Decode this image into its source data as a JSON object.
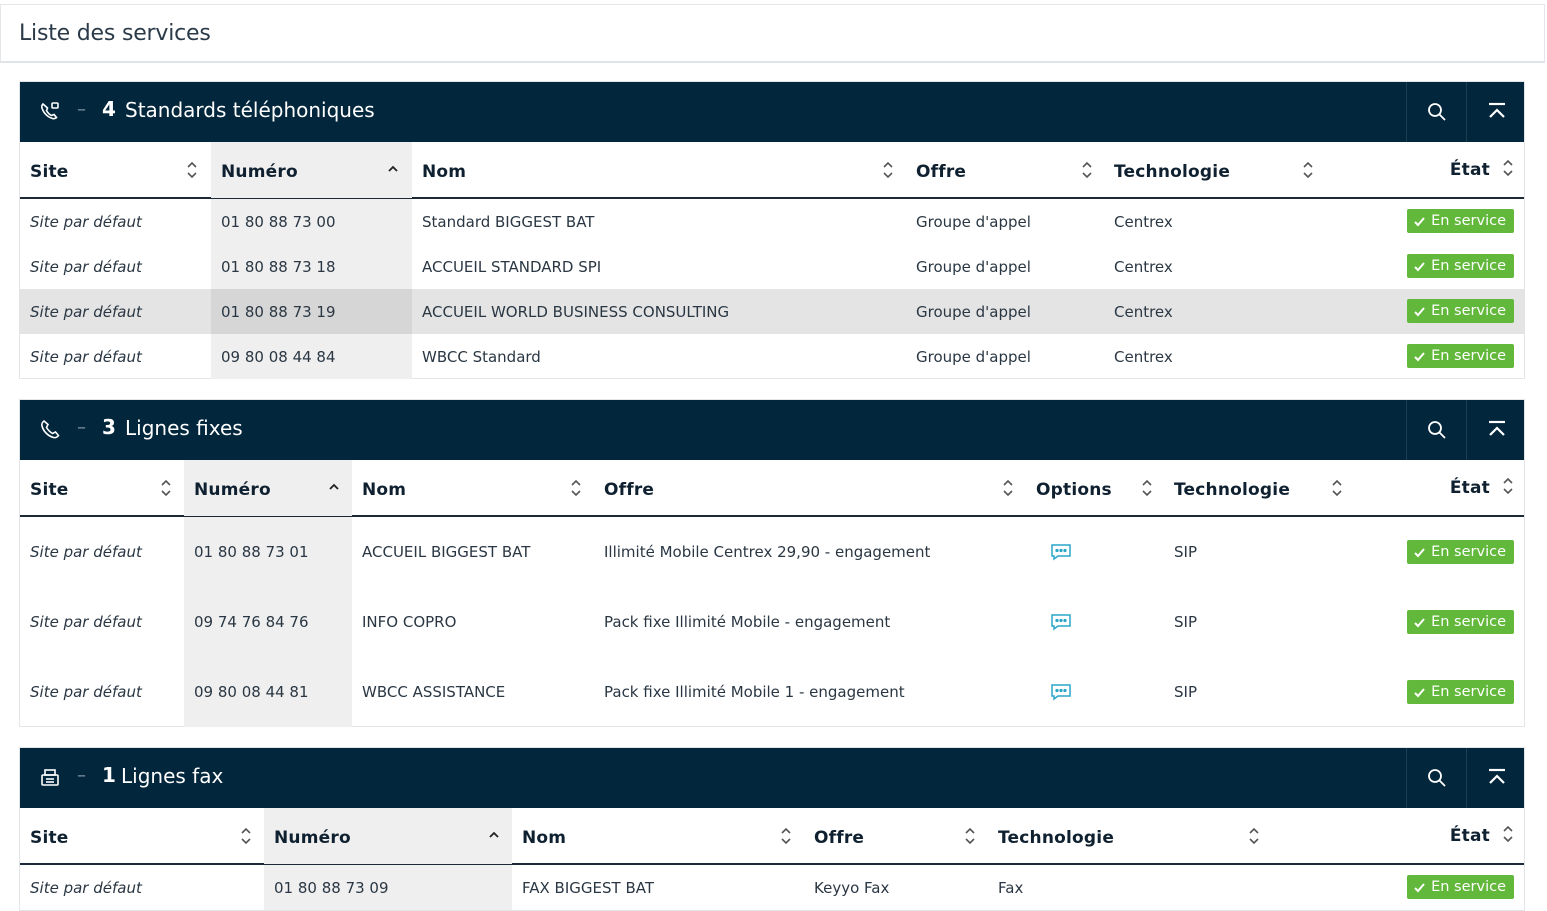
{
  "page": {
    "title": "Liste des services"
  },
  "status_color": "#62b83a",
  "header_color": "#02263c",
  "sections": [
    {
      "icon": "phone-switchboard-icon",
      "count": "4",
      "title": "Standards téléphoniques",
      "columns": [
        "Site",
        "Numéro",
        "Nom",
        "Offre",
        "Technologie",
        "État"
      ],
      "rows": [
        {
          "site": "Site par défaut",
          "numero": "01 80 88 73 00",
          "nom": "Standard BIGGEST BAT",
          "offre": "Groupe d'appel",
          "technologie": "Centrex",
          "etat": "En service"
        },
        {
          "site": "Site par défaut",
          "numero": "01 80 88 73 18",
          "nom": "ACCUEIL STANDARD SPI",
          "offre": "Groupe d'appel",
          "technologie": "Centrex",
          "etat": "En service"
        },
        {
          "site": "Site par défaut",
          "numero": "01 80 88 73 19",
          "nom": "ACCUEIL WORLD BUSINESS CONSULTING",
          "offre": "Groupe d'appel",
          "technologie": "Centrex",
          "etat": "En service"
        },
        {
          "site": "Site par défaut",
          "numero": "09 80 08 44 84",
          "nom": "WBCC Standard",
          "offre": "Groupe d'appel",
          "technologie": "Centrex",
          "etat": "En service"
        }
      ]
    },
    {
      "icon": "phone-icon",
      "count": "3",
      "title": "Lignes fixes",
      "columns": [
        "Site",
        "Numéro",
        "Nom",
        "Offre",
        "Options",
        "Technologie",
        "État"
      ],
      "rows": [
        {
          "site": "Site par défaut",
          "numero": "01 80 88 73 01",
          "nom": "ACCUEIL BIGGEST BAT",
          "offre": "Illimité Mobile Centrex 29,90 - engagement",
          "options": "message-icon",
          "technologie": "SIP",
          "etat": "En service"
        },
        {
          "site": "Site par défaut",
          "numero": "09 74 76 84 76",
          "nom": "INFO COPRO",
          "offre": "Pack fixe Illimité Mobile - engagement",
          "options": "message-icon",
          "technologie": "SIP",
          "etat": "En service"
        },
        {
          "site": "Site par défaut",
          "numero": "09 80 08 44 81",
          "nom": "WBCC ASSISTANCE",
          "offre": "Pack fixe Illimité Mobile 1 - engagement",
          "options": "message-icon",
          "technologie": "SIP",
          "etat": "En service"
        }
      ]
    },
    {
      "icon": "fax-icon",
      "count": "1",
      "title": "Lignes fax",
      "columns": [
        "Site",
        "Numéro",
        "Nom",
        "Offre",
        "Technologie",
        "État"
      ],
      "rows": [
        {
          "site": "Site par défaut",
          "numero": "01 80 88 73 09",
          "nom": "FAX BIGGEST BAT",
          "offre": "Keyyo Fax",
          "technologie": "Fax",
          "etat": "En service"
        }
      ]
    }
  ]
}
